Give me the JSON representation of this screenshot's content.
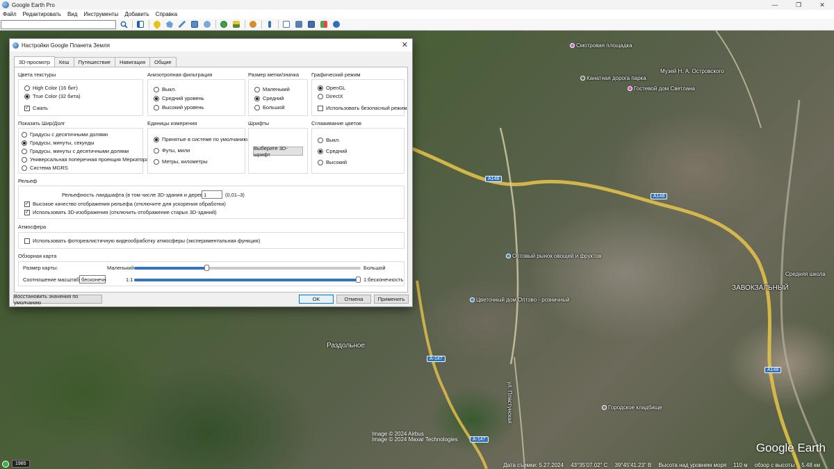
{
  "window": {
    "title": "Google Earth Pro",
    "controls": [
      "—",
      "❐",
      "✕"
    ]
  },
  "menu": [
    "Файл",
    "Редактировать",
    "Вид",
    "Инструменты",
    "Добавить",
    "Справка"
  ],
  "search": {
    "value": "",
    "placeholder": ""
  },
  "map": {
    "labels": {
      "viewpoint": "Смотровая площадка",
      "museum": "Музей Н. А. Островского",
      "cablecar": "Канатная дорога парка",
      "guesthouse": "Гостевой дом Светлана",
      "market": "Оптовый рынок овощей и фруктов",
      "flowers": "Цветочный дом Оптово - розничный",
      "razdolnoe": "Раздольное",
      "zavokzalny": "ЗАВОКЗАЛЬНЫЙ",
      "cemetery": "Городское кладбище",
      "school": "Средняя школа",
      "street": "ул. Пластунская"
    },
    "road_shields": {
      "a148_1": "А148",
      "a148_2": "А148",
      "a148_3": "А148",
      "a147_1": "А-147",
      "a147_2": "А-147"
    },
    "copyright_1": "Image © 2024 Airbus",
    "copyright_2": "Image © 2024 Maxar Technologies",
    "logo": "Google Earth",
    "year": "1985",
    "status": {
      "date": "Дата съемки: 5.27.2024",
      "lat": "43°35'07.02\" С",
      "lon": "39°45'41.23\" В",
      "alt": "Высота над уровнем моря",
      "alt_val": "110 м",
      "eye": "обзор с высоты",
      "eye_val": "5.48 км"
    }
  },
  "dialog": {
    "title": "Настройки Google Планета Земля",
    "close": "✕",
    "tabs": [
      "3D-просмотр",
      "Кеш",
      "Путешествие",
      "Навигация",
      "Общие"
    ],
    "texture": {
      "caption": "Цвета текстуры",
      "opt1": "High Color (16 бит)",
      "opt2": "True Color (32 бита)",
      "compress": "Сжать"
    },
    "aniso": {
      "caption": "Анизотропная фильтрация",
      "opt1": "Выкл.",
      "opt2": "Средний уровень",
      "opt3": "Высокий уровень"
    },
    "labelsize": {
      "caption": "Размер метки/значка",
      "opt1": "Маленький",
      "opt2": "Средний",
      "opt3": "Большой"
    },
    "graphics": {
      "caption": "Графический режим",
      "opt1": "OpenGL",
      "opt2": "DirectX",
      "safe": "Использовать безопасный режим"
    },
    "latlong": {
      "caption": "Показать Шир/Долг",
      "opt1": "Градусы с десятичными долями",
      "opt2": "Градусы, минуты, секунды",
      "opt3": "Градусы, минуты с десятичными долями",
      "opt4": "Универсальная поперечная проекция Меркатора",
      "opt5": "Система MGRS"
    },
    "units": {
      "caption": "Единицы измерения",
      "opt1": "Принятые в системе по умолчанию",
      "opt2": "Футы, мили",
      "opt3": "Метры, километры"
    },
    "fonts": {
      "caption": "Шрифты",
      "button": "Выберите 3D-шрифт"
    },
    "smoothing": {
      "caption": "Сглаживание цветов",
      "opt1": "Выкл.",
      "opt2": "Средний",
      "opt3": "Высокий"
    },
    "terrain": {
      "caption": "Рельеф",
      "exag_label": "Рельефность ландшафта (в том числе 3D-здания и деревья):",
      "exag_value": "1",
      "exag_range": "(0,01–3)",
      "hq": "Высокое качество отображения рельефа (отключите для ускорения обработки)",
      "use3d": "Использовать 3D-изображения (отключить отображение старых 3D-зданий)"
    },
    "atmos": {
      "caption": "Атмосфера",
      "photo": "Использовать фотореалистичную видеообработку атмосферы (экспериментальная функция)"
    },
    "overview": {
      "caption": "Обзорная карта",
      "size_label": "Размер карты:",
      "small": "Маленький",
      "big": "Большой",
      "ratio_label": "Соотношение масштаба:",
      "ratio_value": "бесконечн",
      "one": "1:1",
      "inf": "1:бесконечность",
      "size_level": 0.32,
      "ratio_level": 1.0
    },
    "restore": "Восстановить значения по умолчанию",
    "ok": "OK",
    "cancel": "Отмена",
    "apply": "Применить"
  }
}
